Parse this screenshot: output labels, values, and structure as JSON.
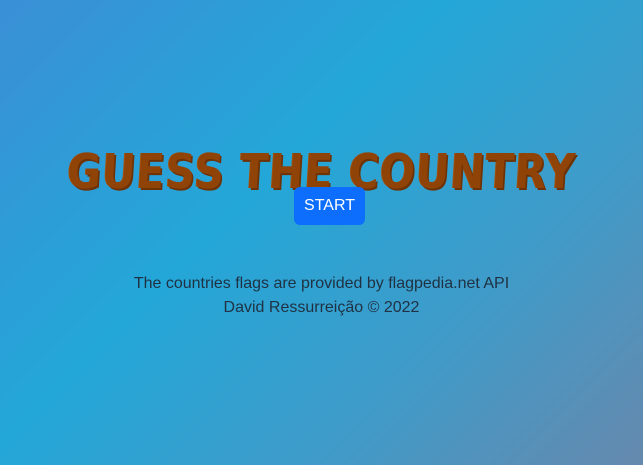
{
  "game": {
    "title": "GUESS THE COUNTRY",
    "start_label": "START"
  },
  "footer": {
    "credits": "The countries flags are provided by flagpedia.net API",
    "author": "David Ressurreição © 2022"
  },
  "colors": {
    "title": "#8f4307",
    "start_button": "#0d6efd",
    "footer_text": "#1f3142"
  }
}
